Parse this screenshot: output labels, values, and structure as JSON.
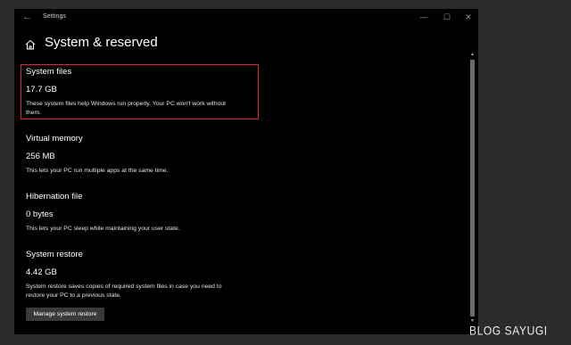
{
  "window": {
    "back_glyph": "←",
    "title": "Settings",
    "controls": {
      "minimize": "—",
      "maximize": "☐",
      "close": "✕"
    }
  },
  "page": {
    "title": "System & reserved",
    "home_icon": "home-icon"
  },
  "sections": [
    {
      "title": "System files",
      "value": "17.7 GB",
      "description": "These system files help Windows run properly. Your PC won't work without them.",
      "highlighted": true
    },
    {
      "title": "Virtual memory",
      "value": "256 MB",
      "description": "This lets your PC run multiple apps at the same time."
    },
    {
      "title": "Hibernation file",
      "value": "0 bytes",
      "description": "This lets your PC sleep while maintaining your user state."
    },
    {
      "title": "System restore",
      "value": "4.42 GB",
      "description": "System restore saves copies of required system files in case you need to restore your PC to a previous state."
    }
  ],
  "actions": {
    "manage_restore_label": "Manage system restore"
  },
  "scrollbar": {
    "up_glyph": "▲",
    "down_glyph": "▼"
  },
  "watermark": "BLOG SAYUGI",
  "colors": {
    "background": "#000000",
    "outer": "#2b2b2b",
    "highlight_border": "#e0243a",
    "button": "#3a3a3a",
    "scroll_thumb": "#6b6b6b"
  }
}
